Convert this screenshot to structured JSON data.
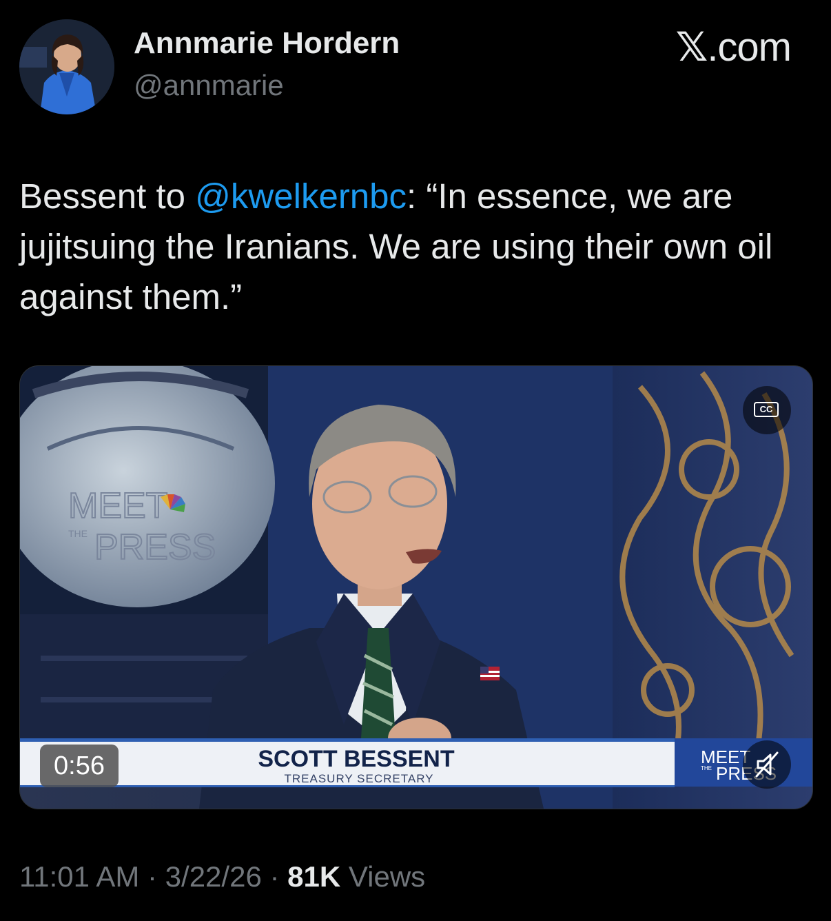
{
  "author": {
    "name": "Annmarie Hordern",
    "handle": "@annmarie"
  },
  "brand": {
    "label_x": "𝕏",
    "label_rest": ".com"
  },
  "tweet": {
    "prefix": "Bessent to ",
    "mention": "@kwelkernbc",
    "body": ": “In essence, we are jujitsuing the Iranians. We are using their own oil against them.”"
  },
  "video": {
    "duration": "0:56",
    "cc_label": "CC",
    "lower_third_name": "SCOTT BESSENT",
    "lower_third_title": "TREASURY SECRETARY",
    "bug_line1": "MEET",
    "bug_the": "THE",
    "bug_line2": "PRESS",
    "backdrop_logo_line1": "MEET",
    "backdrop_logo_the": "THE",
    "backdrop_logo_line2": "PRESS"
  },
  "meta": {
    "time": "11:01 AM",
    "sep1": " · ",
    "date": "3/22/26",
    "sep2": " · ",
    "views_count": "81K",
    "views_label": " Views"
  },
  "colors": {
    "background": "#000000",
    "text_primary": "#e7e9ea",
    "text_secondary": "#71767b",
    "link": "#1d9bf0"
  }
}
